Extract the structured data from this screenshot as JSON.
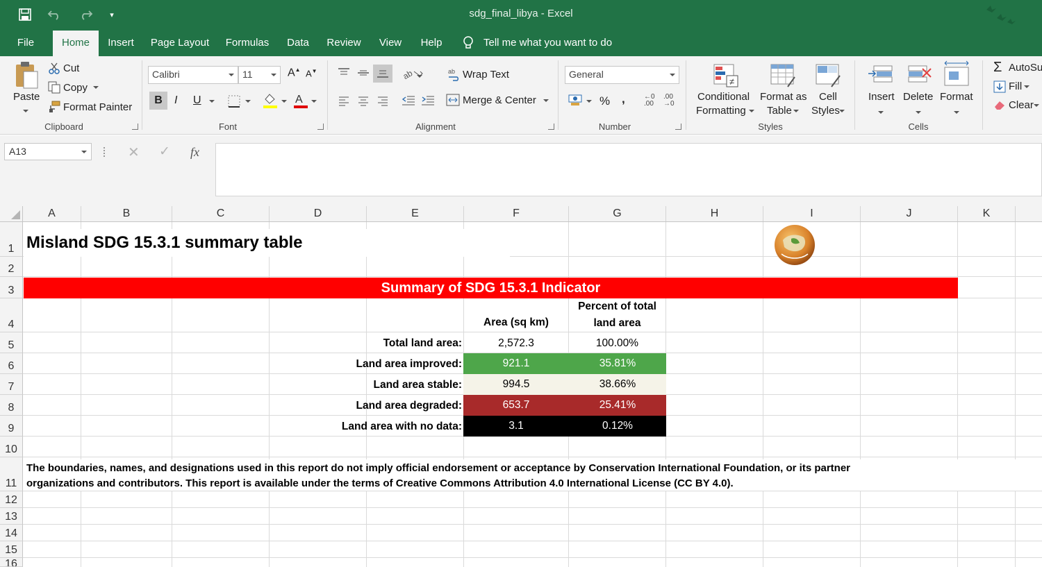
{
  "window": {
    "title": "sdg_final_libya  -  Excel"
  },
  "tabs": [
    "File",
    "Home",
    "Insert",
    "Page Layout",
    "Formulas",
    "Data",
    "Review",
    "View",
    "Help"
  ],
  "active_tab": "Home",
  "tell_me": "Tell me what you want to do",
  "clipboard": {
    "paste": "Paste",
    "cut": "Cut",
    "copy": "Copy",
    "format_painter": "Format Painter",
    "label": "Clipboard"
  },
  "font": {
    "name": "Calibri",
    "size": "11",
    "bold": "B",
    "italic": "I",
    "underline": "U",
    "label": "Font"
  },
  "alignment": {
    "wrap": "Wrap Text",
    "merge": "Merge & Center",
    "label": "Alignment"
  },
  "number": {
    "format": "General",
    "percent": "%",
    "comma": ",",
    "label": "Number"
  },
  "styles": {
    "conditional_1": "Conditional",
    "conditional_2": "Formatting",
    "table_1": "Format as",
    "table_2": "Table",
    "cell_1": "Cell",
    "cell_2": "Styles",
    "label": "Styles"
  },
  "cells": {
    "insert": "Insert",
    "delete": "Delete",
    "format": "Format",
    "label": "Cells"
  },
  "editing": {
    "autosum": "AutoSu",
    "fill": "Fill",
    "clear": "Clear"
  },
  "formula_bar": {
    "name_box": "A13",
    "fx": "fx",
    "content": ""
  },
  "columns": [
    "A",
    "B",
    "C",
    "D",
    "E",
    "F",
    "G",
    "H",
    "I",
    "J",
    "K"
  ],
  "rows": [
    "1",
    "2",
    "3",
    "4",
    "5",
    "6",
    "7",
    "8",
    "9",
    "10",
    "11",
    "12",
    "13",
    "14",
    "15",
    "16"
  ],
  "sheet": {
    "title": "Misland SDG 15.3.1 summary table",
    "banner": "Summary of SDG 15.3.1 Indicator",
    "header_area": "Area (sq km)",
    "header_pct_1": "Percent of total",
    "header_pct_2": "land area",
    "table": [
      {
        "label": "Total land area:",
        "area": "2,572.3",
        "pct": "100.00%"
      },
      {
        "label": "Land area improved:",
        "area": "921.1",
        "pct": "35.81%"
      },
      {
        "label": "Land area stable:",
        "area": "994.5",
        "pct": "38.66%"
      },
      {
        "label": "Land area degraded:",
        "area": "653.7",
        "pct": "25.41%"
      },
      {
        "label": "Land area with no data:",
        "area": "3.1",
        "pct": "0.12%"
      }
    ],
    "disclaimer_1": "The boundaries, names, and designations used in this report do not imply official endorsement or acceptance by Conservation International Foundation, or its partner",
    "disclaimer_2": "organizations and contributors.  This report is available under the terms of Creative Commons Attribution 4.0 International License (CC BY 4.0)."
  },
  "colors": {
    "excel_green": "#217346",
    "banner_red": "#ff0000",
    "improved_green": "#4ea64a",
    "stable_cream": "#f5f3e8",
    "degraded_red": "#a82a2a",
    "nodata_black": "#000000"
  }
}
